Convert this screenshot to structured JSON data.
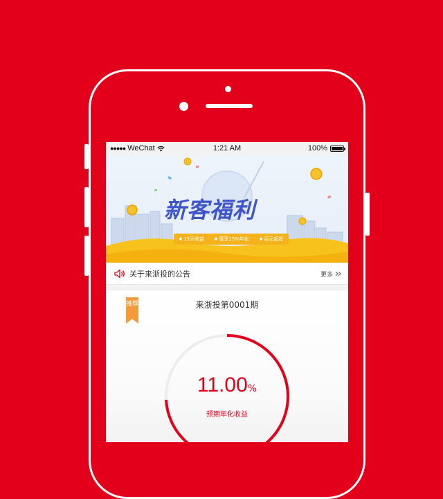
{
  "statusbar": {
    "signal": "●●●●●",
    "carrier": "WeChat",
    "time": "1:21 AM",
    "battery": "100%"
  },
  "banner": {
    "title": "新客福利",
    "ribbon": [
      "15天收益",
      "尊享15%年化",
      "百元起投"
    ],
    "pager": {
      "count": 4,
      "active": 3
    }
  },
  "notice": {
    "text": "关于来浙投的公告",
    "more": "更多"
  },
  "product": {
    "tag": "推荐",
    "title": "来浙投第0001期",
    "rate_value": "11.00",
    "rate_unit": "%",
    "rate_label": "预期年化收益"
  },
  "colors": {
    "brand": "#e3001b",
    "banner_blue": "#3f55c8",
    "ribbon_yellow": "#f6b21a",
    "tag_orange": "#f39a3a"
  }
}
